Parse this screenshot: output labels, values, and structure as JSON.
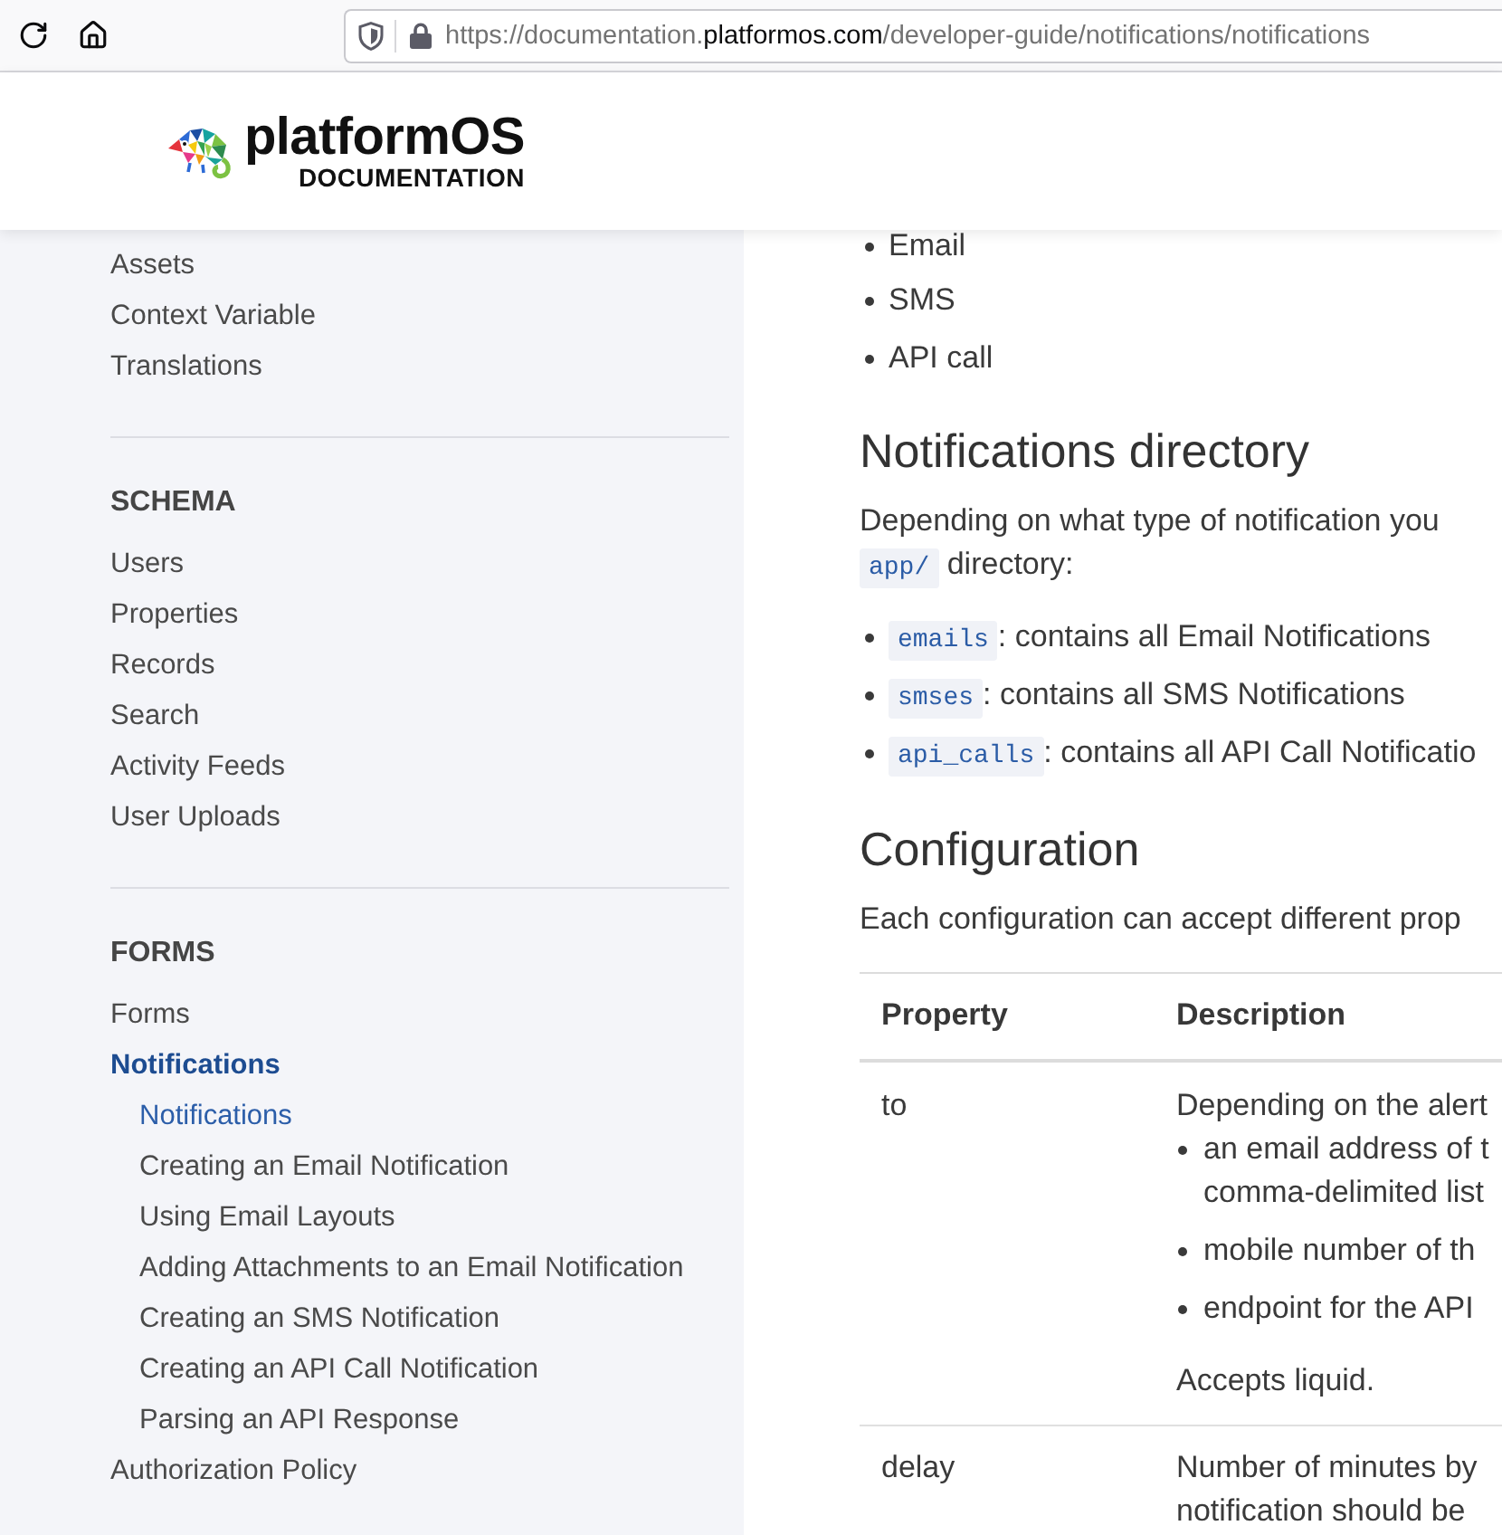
{
  "browser": {
    "address_bar": {
      "prefix": "https://documentation.",
      "domain": "platformos.com",
      "path": "/developer-guide/notifications/notifications"
    }
  },
  "header": {
    "logo": {
      "name": "platformOS",
      "subtitle": "DOCUMENTATION"
    }
  },
  "sidebar": {
    "sections": [
      {
        "items": [
          {
            "label": "Assets",
            "selected": false,
            "expanded": false
          },
          {
            "label": "Context Variable",
            "selected": false,
            "expanded": false
          },
          {
            "label": "Translations",
            "selected": false,
            "expanded": false
          }
        ]
      },
      {
        "heading": "SCHEMA",
        "items": [
          {
            "label": "Users",
            "selected": false,
            "expanded": false
          },
          {
            "label": "Properties",
            "selected": false,
            "expanded": false
          },
          {
            "label": "Records",
            "selected": false,
            "expanded": false
          },
          {
            "label": "Search",
            "selected": false,
            "expanded": false
          },
          {
            "label": "Activity Feeds",
            "selected": false,
            "expanded": false
          },
          {
            "label": "User Uploads",
            "selected": false,
            "expanded": false
          }
        ]
      },
      {
        "heading": "FORMS",
        "items": [
          {
            "label": "Forms",
            "selected": false,
            "expanded": false
          },
          {
            "label": "Notifications",
            "selected": true,
            "expanded": true,
            "children": [
              {
                "label": "Notifications",
                "selected": true
              },
              {
                "label": "Creating an Email Notification",
                "selected": false
              },
              {
                "label": "Using Email Layouts",
                "selected": false
              },
              {
                "label": "Adding Attachments to an Email Notification",
                "selected": false
              },
              {
                "label": "Creating an SMS Notification",
                "selected": false
              },
              {
                "label": "Creating an API Call Notification",
                "selected": false
              },
              {
                "label": "Parsing an API Response",
                "selected": false
              }
            ]
          },
          {
            "label": "Authorization Policy",
            "selected": false,
            "expanded": false
          }
        ]
      }
    ]
  },
  "content": {
    "top_list": [
      "Email",
      "SMS",
      "API call"
    ],
    "directory": {
      "heading": "Notifications directory",
      "paragraph": {
        "text": "Depending on what type of notification you",
        "code": "app/",
        "text_after": "directory:"
      },
      "items": [
        {
          "code": "emails",
          "text": ": contains all Email Notifications"
        },
        {
          "code": "smses",
          "text": ": contains all SMS Notifications"
        },
        {
          "code": "api_calls",
          "text": ": contains all API Call Notificatio"
        }
      ]
    },
    "configuration": {
      "heading": "Configuration",
      "paragraph": {
        "text": "Each configuration can accept different prop"
      },
      "table": {
        "columns": [
          "Property",
          "Description"
        ],
        "rows": [
          {
            "property": "to",
            "description": {
              "lines": [
                "Depending on the alert"
              ],
              "bullets": [
                {
                  "lines": [
                    "an email address of t",
                    "comma-delimited list"
                  ]
                },
                {
                  "lines": [
                    "mobile number of th"
                  ]
                },
                {
                  "lines": [
                    "endpoint for the API"
                  ]
                }
              ],
              "note": "Accepts liquid."
            }
          },
          {
            "property": "delay",
            "description": {
              "lines": [
                "Number of minutes by",
                "notification should be"
              ]
            }
          }
        ]
      }
    }
  }
}
